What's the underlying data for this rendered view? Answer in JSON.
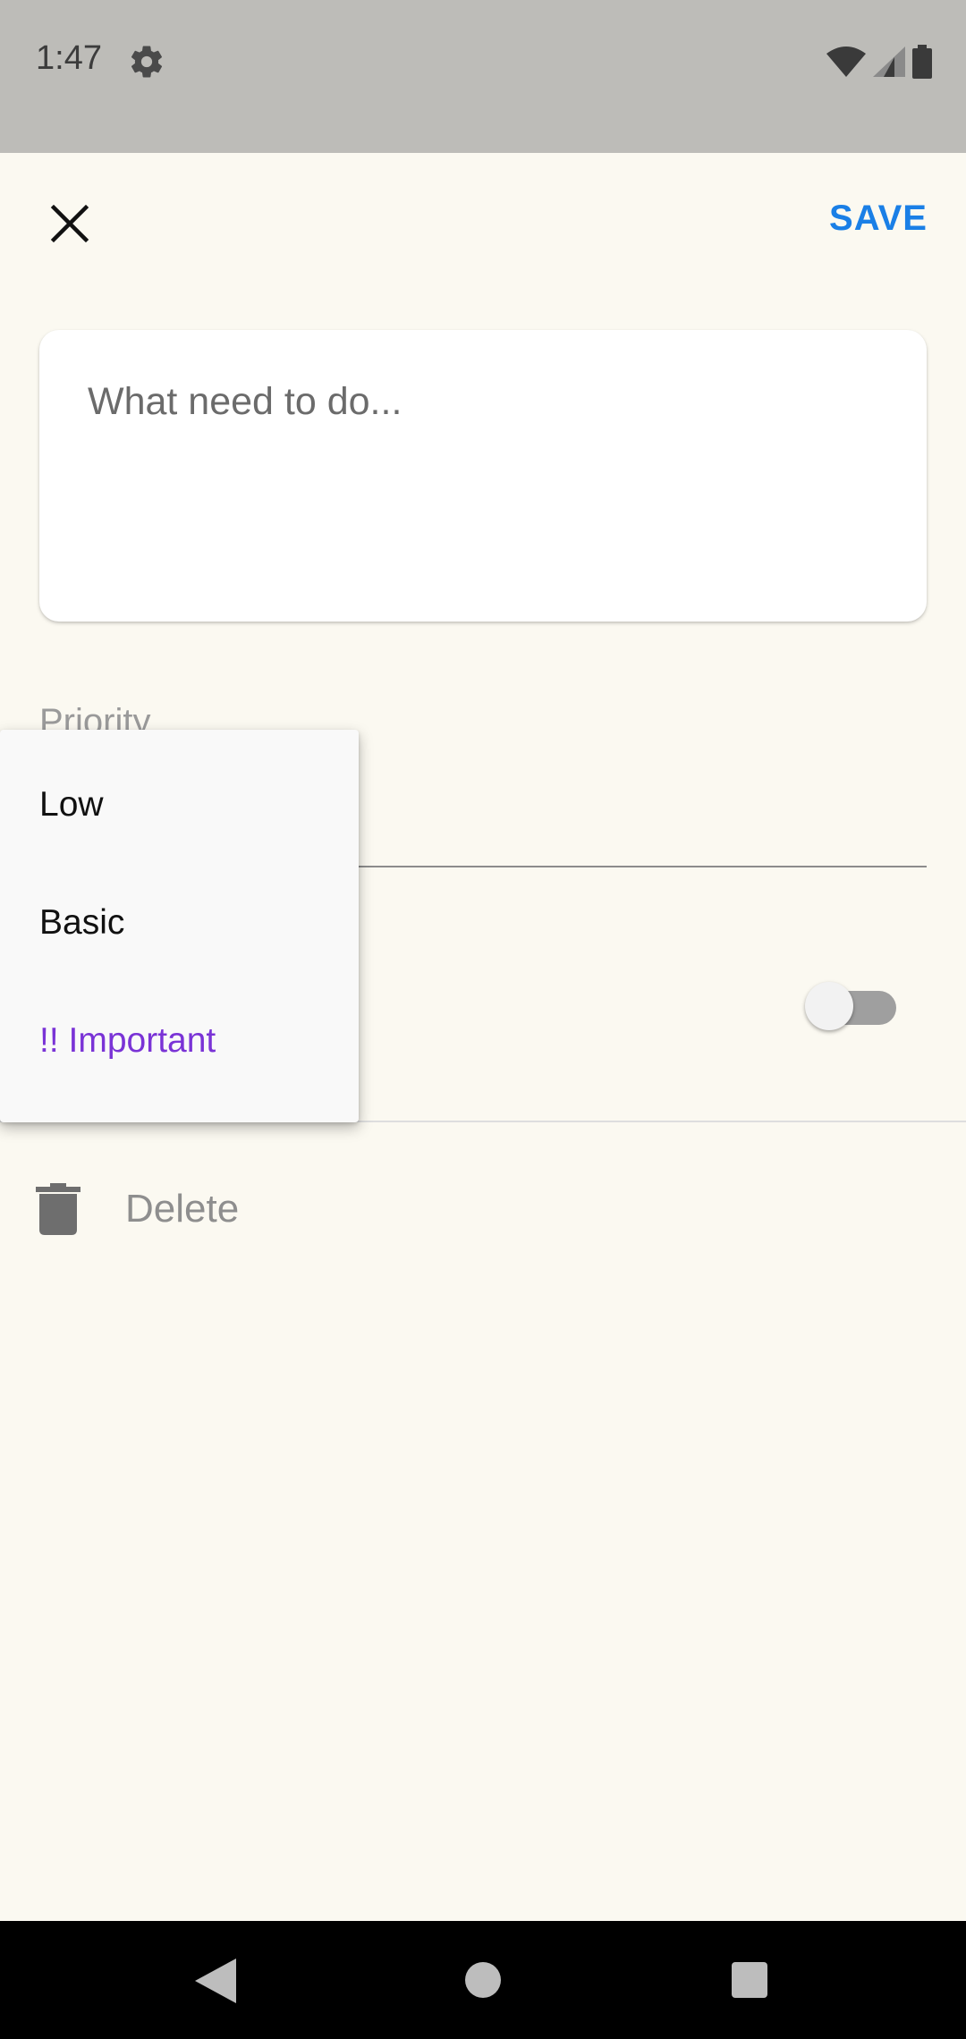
{
  "status_bar": {
    "time": "1:47"
  },
  "app_bar": {
    "close_icon": "close-icon",
    "save_label": "SAVE"
  },
  "task_input": {
    "placeholder": "What need to do..."
  },
  "priority": {
    "label": "Priority"
  },
  "priority_menu": {
    "items": [
      {
        "label": "Low"
      },
      {
        "label": "Basic"
      },
      {
        "label": "!! Important",
        "color": "#7a33d6"
      }
    ]
  },
  "toggle": {
    "state": "off"
  },
  "delete": {
    "label": "Delete",
    "icon": "trash-icon"
  },
  "colors": {
    "accent": "#1a7fe6",
    "background": "#fbf9f1",
    "important": "#7a33d6"
  }
}
